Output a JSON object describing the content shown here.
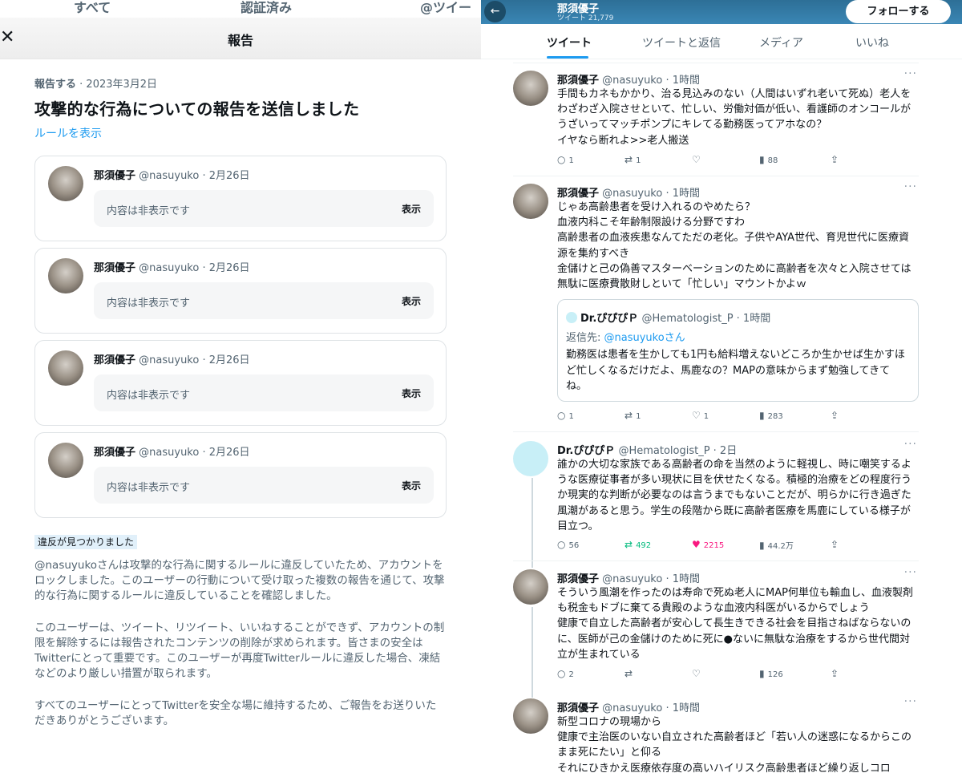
{
  "left": {
    "top_tabs": [
      "すべて",
      "認証済み",
      "@ツイート"
    ],
    "modal_title": "報告",
    "close_icon": "close-icon",
    "meta_label": "報告する",
    "meta_date": "· 2023年3月2日",
    "heading": "攻撃的な行為についての報告を送信しました",
    "rules_link": "ルールを表示",
    "cards": [
      {
        "name": "那須優子",
        "handle": "@nasuyuko · 2月26日",
        "hidden_text": "内容は非表示です",
        "show_label": "表示"
      },
      {
        "name": "那須優子",
        "handle": "@nasuyuko · 2月26日",
        "hidden_text": "内容は非表示です",
        "show_label": "表示"
      },
      {
        "name": "那須優子",
        "handle": "@nasuyuko · 2月26日",
        "hidden_text": "内容は非表示です",
        "show_label": "表示"
      },
      {
        "name": "那須優子",
        "handle": "@nasuyuko · 2月26日",
        "hidden_text": "内容は非表示です",
        "show_label": "表示"
      }
    ],
    "violation_badge": "違反が見つかりました",
    "paragraph1": "@nasuyukoさんは攻撃的な行為に関するルールに違反していたため、アカウントをロックしました。このユーザーの行動について受け取った複数の報告を通じて、攻撃的な行為に関するルールに違反していることを確認しました。",
    "paragraph2": "このユーザーは、ツイート、リツイート、いいねすることができず、アカウントの制限を解除するには報告されたコンテンツの削除が求められます。皆さまの安全はTwitterにとって重要です。このユーザーが再度Twitterルールに違反した場合、凍結などのより厳しい措置が取られます。",
    "paragraph3": "すべてのユーザーにとってTwitterを安全な場に維持するため、ご報告をお送りいただきありがとうございます。"
  },
  "right": {
    "profile_name": "那須優子",
    "tweet_count": "ツイート 21,779",
    "follow_label": "フォローする",
    "tabs": [
      "ツイート",
      "ツイートと返信",
      "メディア",
      "いいね"
    ],
    "tweets": [
      {
        "name": "那須優子",
        "handle": "@nasuyuko · 1時間",
        "text": "手間もカネもかかり、治る見込みのない（人間はいずれ老いて死ぬ）老人をわざわざ入院させといて、忙しい、労働対価が低い、看護師のオンコールがうざいってマッチポンプにキレてる勤務医ってアホなの？\nイヤなら断れよ>>老人搬送",
        "replies": "1",
        "retweets": "1",
        "likes": "",
        "views": "88"
      },
      {
        "name": "那須優子",
        "handle": "@nasuyuko · 1時間",
        "text": "じゃあ高齢患者を受け入れるのやめたら？\n血液内科こそ年齢制限設ける分野ですわ\n高齢患者の血液疾患なんてただの老化。子供やAYA世代、育児世代に医療資源を集約すべき\n金儲けと己の偽善マスターベーションのために高齢者を次々と入院させては無駄に医療費散財しといて「忙しい」マウントかよｗ",
        "replies": "1",
        "retweets": "1",
        "likes": "1",
        "views": "283",
        "quote": {
          "name": "Dr.ぴぴぴＰ",
          "handle": "@Hematologist_P · 1時間",
          "reply_prefix": "返信先: ",
          "reply_to": "@nasuyukoさん",
          "text": "勤務医は患者を生かしても1円も給料増えないどころか生かせば生かすほど忙しくなるだけだよ、馬鹿なの？MAPの意味からまず勉強してきてね。"
        }
      },
      {
        "name": "Dr.ぴぴぴＰ",
        "handle": "@Hematologist_P · 2日",
        "text": "誰かの大切な家族である高齢者の命を当然のように軽視し、時に嘲笑するような医療従事者が多い現状に目を伏せたくなる。積極的治療をどの程度行うか現実的な判断が必要なのは言うまでもないことだが、明らかに行き過ぎた風潮があると思う。学生の段階から既に高齢者医療を馬鹿にしている様子が目立つ。",
        "replies": "56",
        "retweets": "492",
        "likes": "2215",
        "views": "44.2万"
      },
      {
        "name": "那須優子",
        "handle": "@nasuyuko · 1時間",
        "text": "そういう風潮を作ったのは寿命で死ぬ老人にMAP何単位も輸血し、血液製剤も税金もドブに棄てる貴殿のような血液内科医がいるからでしょう\n健康で自立した高齢者が安心して長生きできる社会を目指さねばならないのに、医師が己の金儲けのために死に●ないに無駄な治療をするから世代間対立が生まれている",
        "replies": "2",
        "retweets": "",
        "likes": "",
        "views": "126"
      },
      {
        "name": "那須優子",
        "handle": "@nasuyuko · 1時間",
        "text": "新型コロナの現場から\n健康で主治医のいない自立された高齢者ほど「若い人の迷惑になるからこのまま死にたい」と仰る\nそれにひきかえ医療依存度の高いハイリスク高齢患者ほど繰り返しコロ",
        "replies": "",
        "retweets": "",
        "likes": "",
        "views": ""
      }
    ]
  },
  "icons": {
    "reply": "reply-icon",
    "retweet": "retweet-icon",
    "like": "heart-icon",
    "views": "views-icon",
    "share": "share-icon",
    "back": "back-arrow-icon",
    "more": "more-icon"
  },
  "colors": {
    "accent": "#1d9bf0",
    "retweet": "#00ba7c",
    "like": "#f91880",
    "header": "#3a86b5"
  }
}
